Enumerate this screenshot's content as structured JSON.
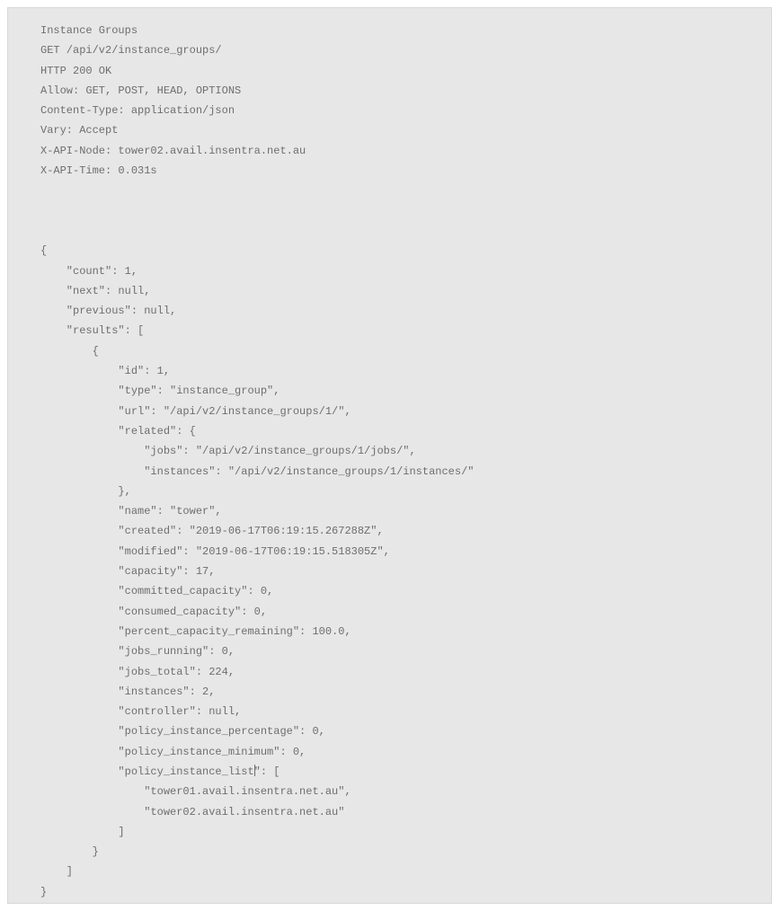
{
  "header": {
    "title": "Instance Groups",
    "request_line": "GET /api/v2/instance_groups/",
    "status_line": "HTTP 200 OK",
    "allow": "Allow: GET, POST, HEAD, OPTIONS",
    "content_type": "Content-Type: application/json",
    "vary": "Vary: Accept",
    "api_node": "X-API-Node: tower02.avail.insentra.net.au",
    "api_time": "X-API-Time: 0.031s"
  },
  "body": {
    "open": "{",
    "count_line": "    \"count\": 1,",
    "next_line": "    \"next\": null,",
    "previous_line": "    \"previous\": null,",
    "results_open": "    \"results\": [",
    "item_open": "        {",
    "id_line": "            \"id\": 1,",
    "type_line": "            \"type\": \"instance_group\",",
    "url_line": "            \"url\": \"/api/v2/instance_groups/1/\",",
    "related_open": "            \"related\": {",
    "related_jobs": "                \"jobs\": \"/api/v2/instance_groups/1/jobs/\",",
    "related_instances": "                \"instances\": \"/api/v2/instance_groups/1/instances/\"",
    "related_close": "            },",
    "name_line": "            \"name\": \"tower\",",
    "created_line": "            \"created\": \"2019-06-17T06:19:15.267288Z\",",
    "modified_line": "            \"modified\": \"2019-06-17T06:19:15.518305Z\",",
    "capacity_line": "            \"capacity\": 17,",
    "committed_line": "            \"committed_capacity\": 0,",
    "consumed_line": "            \"consumed_capacity\": 0,",
    "percent_line": "            \"percent_capacity_remaining\": 100.0,",
    "jobs_running_line": "            \"jobs_running\": 0,",
    "jobs_total_line": "            \"jobs_total\": 224,",
    "instances_line": "            \"instances\": 2,",
    "controller_line": "            \"controller\": null,",
    "policy_pct_line": "            \"policy_instance_percentage\": 0,",
    "policy_min_line": "            \"policy_instance_minimum\": 0,",
    "policy_list_prefix": "            \"policy_instance_list",
    "policy_list_suffix": "\": [",
    "policy_item1": "                \"tower01.avail.insentra.net.au\",",
    "policy_item2": "                \"tower02.avail.insentra.net.au\"",
    "policy_close": "            ]",
    "item_close": "        }",
    "results_close": "    ]",
    "close": "}"
  }
}
